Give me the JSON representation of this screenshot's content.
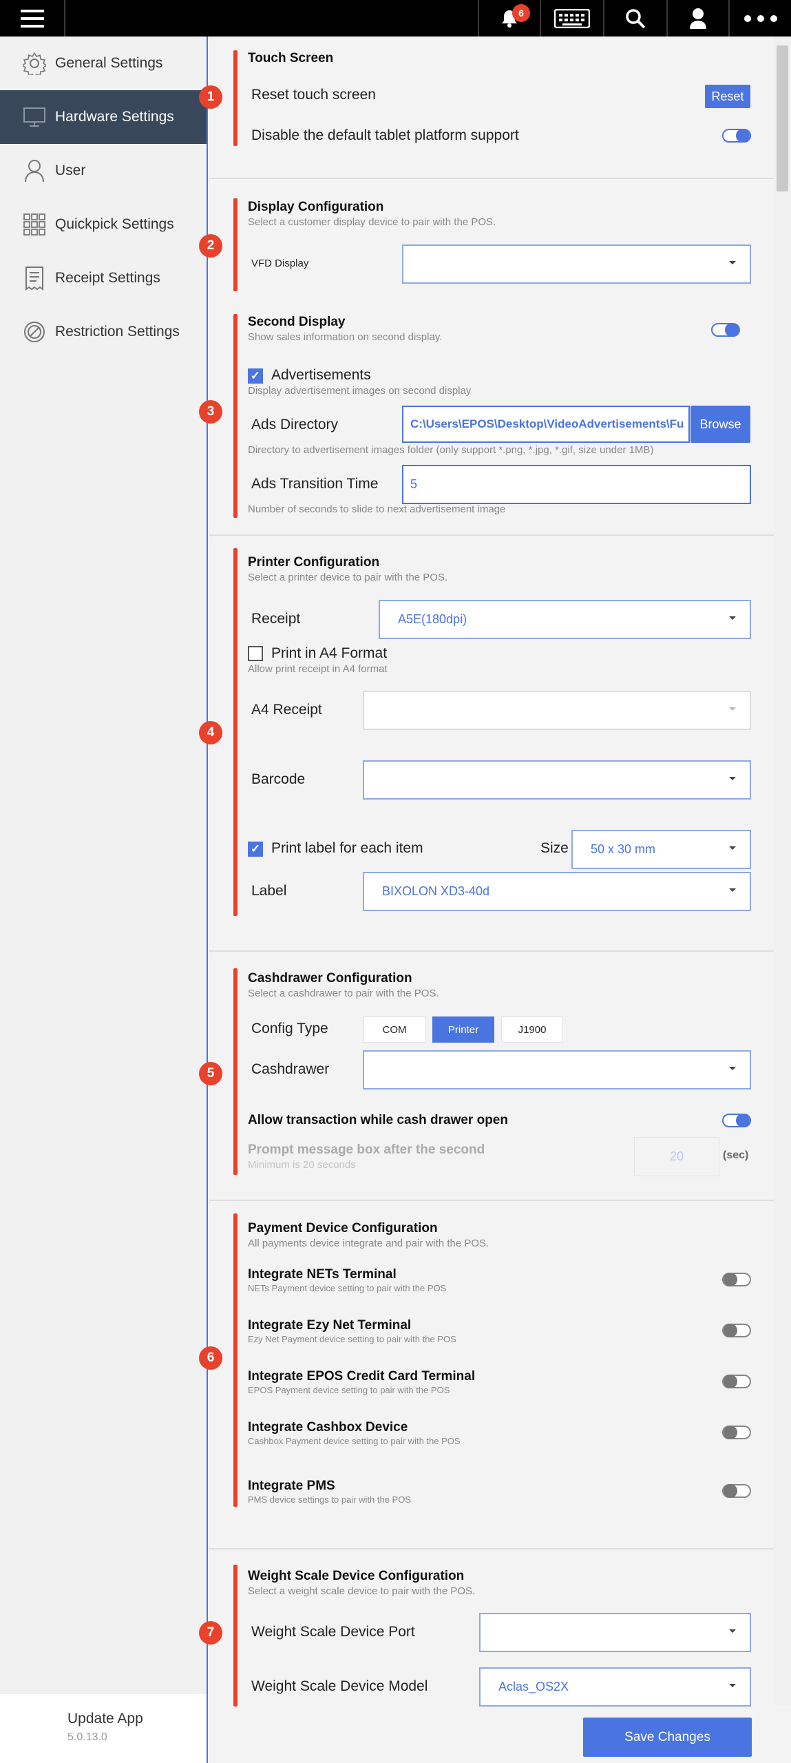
{
  "topbar": {
    "notification_count": "6"
  },
  "sidebar": {
    "items": [
      {
        "label": "General Settings",
        "icon": "gear-icon"
      },
      {
        "label": "Hardware Settings",
        "icon": "monitor-icon"
      },
      {
        "label": "User",
        "icon": "user-icon"
      },
      {
        "label": "Quickpick Settings",
        "icon": "grid-icon"
      },
      {
        "label": "Receipt Settings",
        "icon": "receipt-icon"
      },
      {
        "label": "Restriction Settings",
        "icon": "restriction-icon"
      }
    ],
    "update_label": "Update App",
    "version": "5.0.13.0"
  },
  "sections": {
    "touch": {
      "badge": "1",
      "title": "Touch Screen",
      "reset_label": "Reset touch screen",
      "reset_button": "Reset",
      "disable_label": "Disable the default tablet platform support",
      "disable_on": true
    },
    "display": {
      "badge": "2",
      "title": "Display Configuration",
      "subtitle": "Select a customer display device to pair with the POS.",
      "vfd_label": "VFD Display",
      "vfd_value": ""
    },
    "second": {
      "badge": "3",
      "title": "Second Display",
      "subtitle": "Show sales information on second display.",
      "enabled": true,
      "ads_label": "Advertisements",
      "ads_desc": "Display advertisement images on second display",
      "dir_label": "Ads Directory",
      "dir_value": "C:\\Users\\EPOS\\Desktop\\VideoAdvertisements\\Fu",
      "browse": "Browse",
      "dir_help": "Directory to advertisement images folder (only support *.png, *.jpg, *.gif, size under 1MB)",
      "trans_label": "Ads Transition Time",
      "trans_value": "5",
      "trans_help": "Number of seconds to slide to next advertisement image"
    },
    "printer": {
      "badge": "4",
      "title": "Printer Configuration",
      "subtitle": "Select a printer device to pair with the POS.",
      "receipt_label": "Receipt",
      "receipt_value": "A5E(180dpi)",
      "a4_label": "Print in A4 Format",
      "a4_desc": "Allow print receipt in A4 format",
      "a4_receipt_label": "A4 Receipt",
      "a4_receipt_value": "",
      "barcode_label": "Barcode",
      "barcode_value": "",
      "print_label_text": "Print label for each item",
      "size_label": "Size",
      "size_value": "50 x 30 mm",
      "label_label": "Label",
      "label_value": "BIXOLON XD3-40d"
    },
    "cashdrawer": {
      "badge": "5",
      "title": "Cashdrawer Configuration",
      "subtitle": "Select a cashdrawer to pair with the POS.",
      "config_label": "Config Type",
      "options": [
        "COM",
        "Printer",
        "J1900"
      ],
      "selected": "Printer",
      "drawer_label": "Cashdrawer",
      "drawer_value": "",
      "allow_label": "Allow transaction while cash drawer open",
      "allow_on": true,
      "prompt_label": "Prompt message box after the second",
      "prompt_help": "Minimum is 20 seconds",
      "prompt_value": "20",
      "sec": "(sec)"
    },
    "payment": {
      "badge": "6",
      "title": "Payment Device Configuration",
      "subtitle": "All payments device integrate and pair with the POS.",
      "items": [
        {
          "title": "Integrate NETs Terminal",
          "desc": "NETs Payment device setting to pair with the POS"
        },
        {
          "title": "Integrate Ezy Net Terminal",
          "desc": "Ezy Net Payment device setting to pair with the POS"
        },
        {
          "title": "Integrate EPOS Credit Card Terminal",
          "desc": "EPOS Payment device setting to pair with the POS"
        },
        {
          "title": "Integrate Cashbox Device",
          "desc": "Cashbox Payment device setting to pair with the POS"
        },
        {
          "title": "Integrate PMS",
          "desc": "PMS device settings to pair with the POS"
        }
      ]
    },
    "weight": {
      "badge": "7",
      "title": "Weight Scale Device Configuration",
      "subtitle": "Select a weight scale device to pair with the POS.",
      "port_label": "Weight Scale Device Port",
      "port_value": "",
      "model_label": "Weight Scale Device Model",
      "model_value": "Aclas_OS2X"
    }
  },
  "save_button": "Save Changes",
  "colors": {
    "accent": "#4a74e0",
    "marker": "#e8412c",
    "sidebar_active": "#39475a"
  }
}
